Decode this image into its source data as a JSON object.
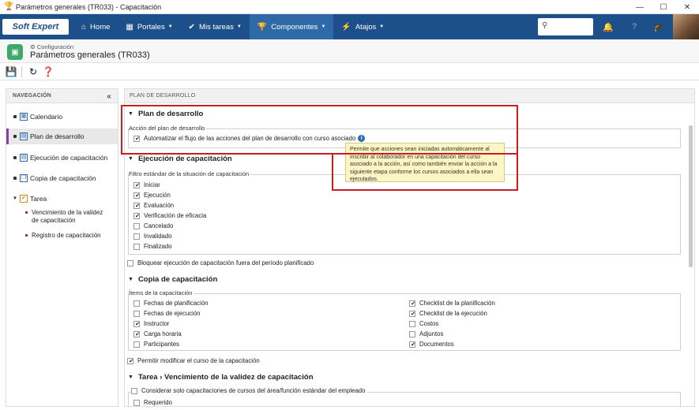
{
  "window": {
    "title": "Parámetros generales (TR033) - Capacitación",
    "controls": [
      "minimize-icon",
      "maximize-icon",
      "close-icon"
    ]
  },
  "topnav": {
    "logo": "Soft Expert",
    "items": [
      {
        "label": "Home",
        "icon": "home-icon"
      },
      {
        "label": "Portales",
        "icon": "grid-icon",
        "has_caret": true
      },
      {
        "label": "Mis tareas",
        "icon": "check-icon",
        "has_caret": true
      },
      {
        "label": "Componentes",
        "icon": "trophy-icon",
        "has_caret": true,
        "active": true
      },
      {
        "label": "Atajos",
        "icon": "lightning-icon",
        "has_caret": true
      }
    ],
    "search_placeholder": "",
    "right_icons": [
      "bell-icon",
      "help-icon",
      "graduation-cap-icon"
    ]
  },
  "header": {
    "breadcrumb": "Configuración",
    "title": "Parámetros generales (TR033)"
  },
  "toolbar": {
    "buttons": [
      "save-icon",
      "refresh-icon",
      "help-icon"
    ]
  },
  "leftnav": {
    "heading": "NAVEGACIÓN",
    "items": [
      {
        "label": "Calendario"
      },
      {
        "label": "Plan de desarrollo",
        "active": true
      },
      {
        "label": "Ejecución de capacitación"
      },
      {
        "label": "Copia de capacitación"
      },
      {
        "label": "Tarea"
      }
    ],
    "subitems": [
      {
        "label": "Vencimiento de la validez de capacitación"
      },
      {
        "label": "Registro de capacitación"
      }
    ]
  },
  "main": {
    "heading": "PLAN DE DESARROLLO",
    "plan": {
      "title": "Plan de desarrollo",
      "group_label": "Acción del plan de desarrollo",
      "option": {
        "label": "Automatizar el flujo de las acciones del plan de desarrollo con curso asociado",
        "checked": true
      }
    },
    "tooltip": "Permite que acciones sean iniciadas automáticamente al inscribir al colaborador en una capacitación del curso asociado a la acción, así como también enviar la acción a la siguiente etapa conforme los cursos asociados a ella sean ejecutados.",
    "ejecucion": {
      "title": "Ejecución de capacitación",
      "group_label": "Filtro estándar de la situación de capacitación",
      "options": [
        {
          "label": "Iniciar",
          "checked": true
        },
        {
          "label": "Ejecución",
          "checked": true
        },
        {
          "label": "Evaluación",
          "checked": true
        },
        {
          "label": "Verificación de eficacia",
          "checked": true
        },
        {
          "label": "Cancelado",
          "checked": false
        },
        {
          "label": "Invalidado",
          "checked": false
        },
        {
          "label": "Finalizado",
          "checked": false
        }
      ],
      "block_option": {
        "label": "Bloquear ejecución de capacitación fuera del período planificado",
        "checked": false
      }
    },
    "copia": {
      "title": "Copia de capacitación",
      "group_label": "Ítems de la capacitación",
      "left_options": [
        {
          "label": "Fechas de planificación",
          "checked": false
        },
        {
          "label": "Fechas de ejecución",
          "checked": false
        },
        {
          "label": "Instructor",
          "checked": true
        },
        {
          "label": "Carga horaria",
          "checked": true
        },
        {
          "label": "Participantes",
          "checked": false
        }
      ],
      "right_options": [
        {
          "label": "Checklist de la planificación",
          "checked": true
        },
        {
          "label": "Checklist de la ejecución",
          "checked": true
        },
        {
          "label": "Costos",
          "checked": false
        },
        {
          "label": "Adjuntos",
          "checked": false
        },
        {
          "label": "Documentos",
          "checked": true
        }
      ],
      "modify_option": {
        "label": "Permitir modificar el curso de la capacitación",
        "checked": true
      }
    },
    "tarea": {
      "title": "Tarea › Vencimiento de la validez de capacitación",
      "group_label": "Considerar solo capacitaciones de cursos del área/función estándar del empleado",
      "group_checked": false,
      "first_option": {
        "label": "Requerido",
        "checked": false
      }
    }
  }
}
